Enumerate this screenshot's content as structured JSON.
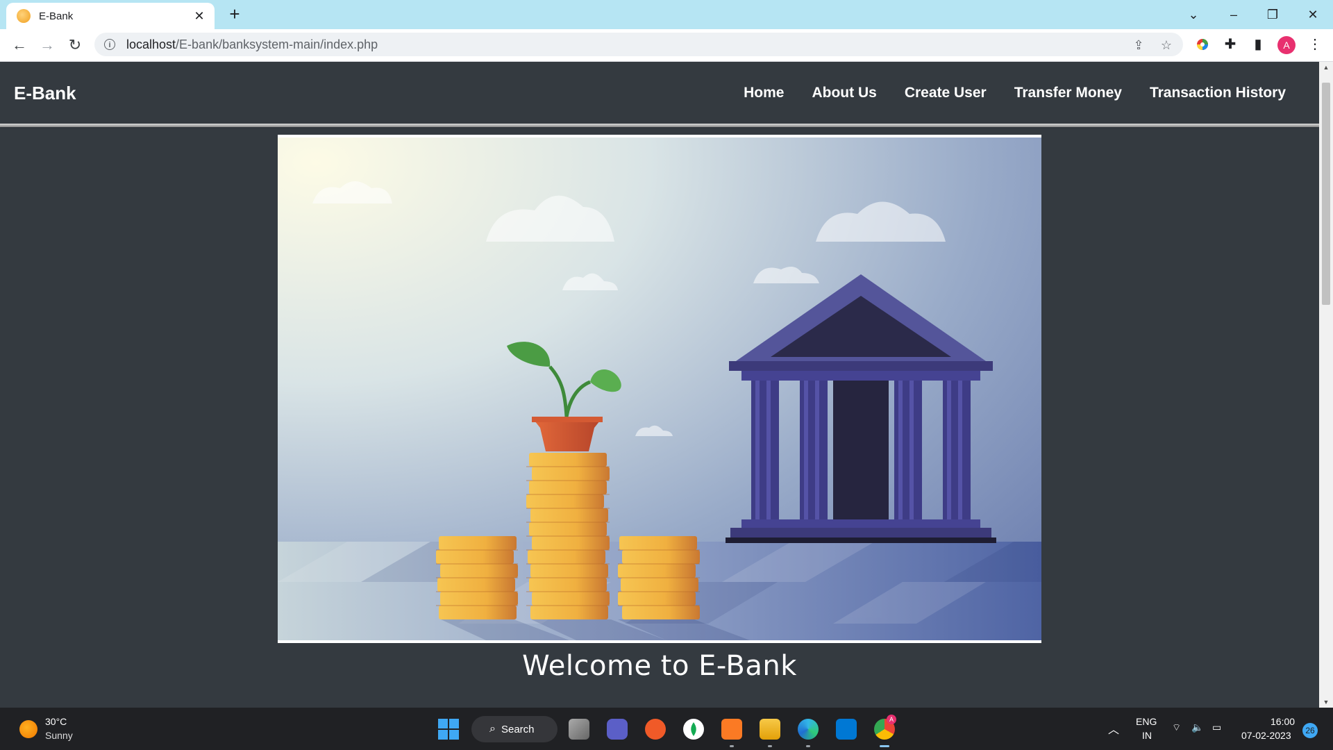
{
  "browser": {
    "tab_title": "E-Bank",
    "url_host": "localhost",
    "url_path": "/E-bank/banksystem-main/index.php",
    "profile_initial": "A"
  },
  "site": {
    "brand": "E-Bank",
    "nav": [
      "Home",
      "About Us",
      "Create User",
      "Transfer Money",
      "Transaction History"
    ],
    "welcome": "Welcome to E-Bank"
  },
  "taskbar": {
    "temperature": "30°C",
    "weather": "Sunny",
    "search_label": "Search",
    "language": "ENG",
    "region": "IN",
    "time": "16:00",
    "date": "07-02-2023",
    "notification_count": "26",
    "chrome_badge": "A"
  },
  "icons": {
    "tab_close": "close-icon",
    "new_tab": "plus-icon",
    "back": "arrow-left-icon",
    "forward": "arrow-right-icon",
    "reload": "reload-icon",
    "site_info": "info-icon",
    "share": "share-icon",
    "bookmark": "star-icon",
    "extensions": "puzzle-icon",
    "side_panel": "side-panel-icon",
    "menu": "more-vert-icon"
  },
  "colors": {
    "page_bg": "#343a40",
    "tab_strip": "#b6e5f3",
    "profile_avatar": "#e8306f"
  }
}
